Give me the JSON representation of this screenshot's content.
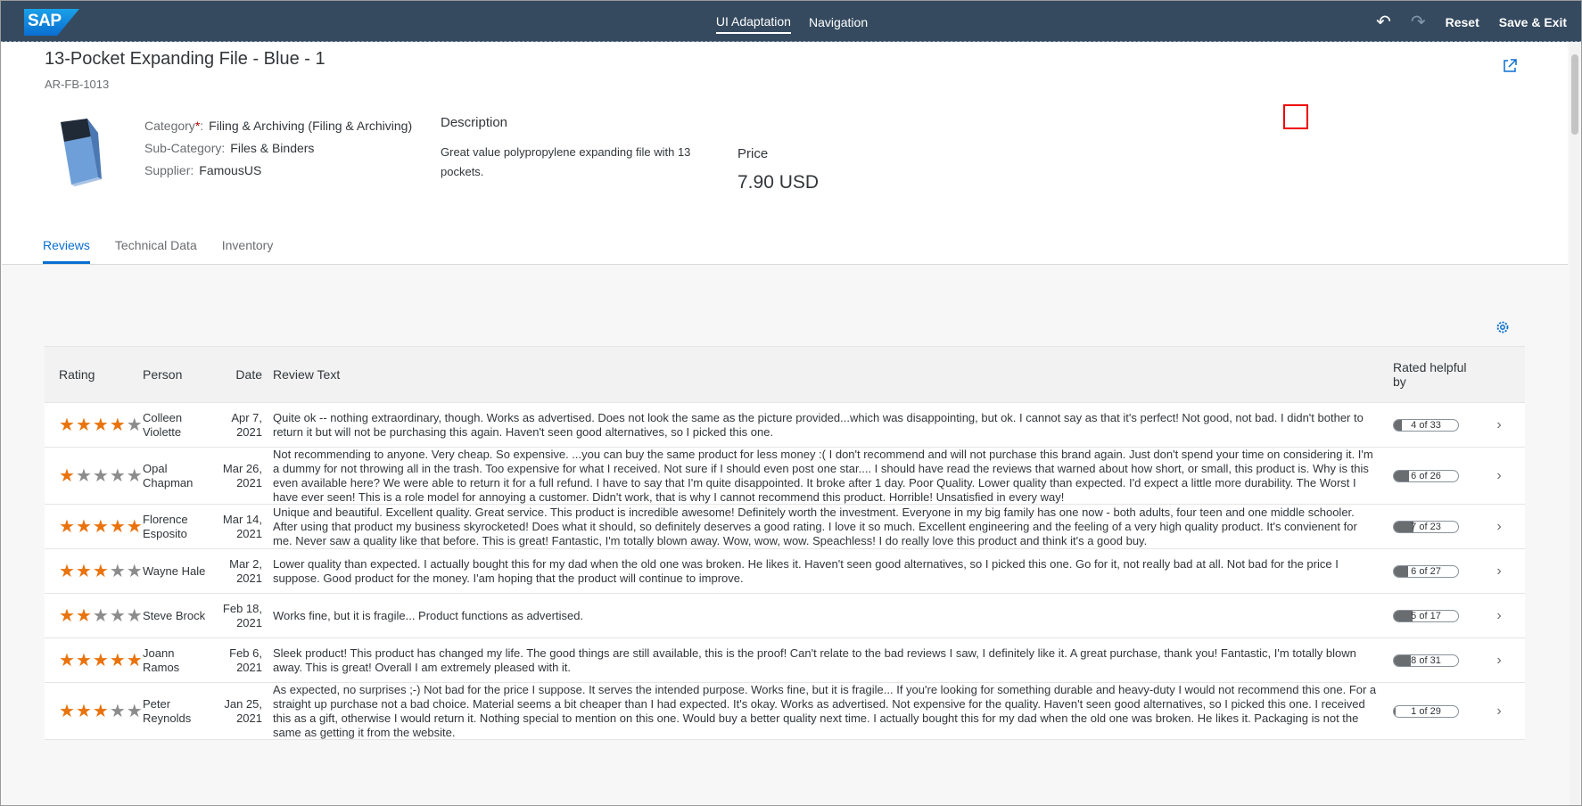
{
  "shell": {
    "logo": "SAP",
    "tabs": [
      "UI Adaptation",
      "Navigation"
    ],
    "reset": "Reset",
    "save_exit": "Save & Exit"
  },
  "header": {
    "title": "13-Pocket Expanding File - Blue - 1",
    "subtitle": "AR-FB-1013",
    "category_label": "Category",
    "category_value": "Filing & Archiving (Filing & Archiving)",
    "subcategory_label": "Sub-Category:",
    "subcategory_value": "Files & Binders",
    "supplier_label": "Supplier:",
    "supplier_value": "FamousUS",
    "description_title": "Description",
    "description_text": "Great value polypropylene expanding file with 13 pockets.",
    "price_title": "Price",
    "price_value": "7.90  USD"
  },
  "tabs": [
    "Reviews",
    "Technical Data",
    "Inventory"
  ],
  "table": {
    "columns": [
      "Rating",
      "Person",
      "Date",
      "Review Text",
      "Rated helpful by"
    ],
    "rows": [
      {
        "rating": 4,
        "person": "Colleen Violette",
        "date": "Apr 7, 2021",
        "text": "Quite ok -- nothing extraordinary, though. Works as advertised. Does not look the same as the picture provided...which was disappointing, but ok. I cannot say as that it's perfect! Not good, not bad. I didn't bother to return it but will not be purchasing this again. Haven't seen good alternatives, so I picked this one.",
        "helpful": "4 of 33",
        "helpful_fraction": 0.12
      },
      {
        "rating": 1,
        "person": "Opal Chapman",
        "date": "Mar 26, 2021",
        "text": "Not recommending to anyone. Very cheap. So expensive. ...you can buy the same product for less money :( I don't recommend and will not purchase this brand again. Just don't spend your time on considering it. I'm a dummy for not throwing all in the trash. Too expensive for what I received. Not sure if I should even post one star.... I should have read the reviews that warned about how short, or small, this product is. Why is this even available here? We were able to return it for a full refund. I have to say that I'm quite disappointed. It broke after 1 day. Poor Quality. Lower quality than expected. I'd expect a little more durability. The Worst I have ever seen! This is a role model for annoying a customer. Didn't work, that is why I cannot recommend this product. Horrible! Unsatisfied in every way!",
        "helpful": "6 of 26",
        "helpful_fraction": 0.23
      },
      {
        "rating": 5,
        "person": "Florence Esposito",
        "date": "Mar 14, 2021",
        "text": "Unique and beautiful. Excellent quality. Great service. This product is incredible awesome! Definitely worth the investment. Everyone in my big family has one now - both adults, four teen and one middle schooler. After using that product my business skyrocketed! Does what it should, so definitely deserves a good rating. I love it so much. Excellent engineering and the feeling of a very high quality product. It's convienent for me. Never saw a quality like that before. This is great! Fantastic, I'm totally blown away. Wow, wow, wow. Speachless! I do really love this product and think it's a good buy.",
        "helpful": "7 of 23",
        "helpful_fraction": 0.3
      },
      {
        "rating": 3,
        "person": "Wayne Hale",
        "date": "Mar 2, 2021",
        "text": "Lower quality than expected. I actually bought this for my dad when the old one was broken. He likes it. Haven't seen good alternatives, so I picked this one. Go for it, not really bad at all. Not bad for the price I suppose. Good product for the money. I'am hoping that the product will continue to improve.",
        "helpful": "6 of 27",
        "helpful_fraction": 0.22
      },
      {
        "rating": 2,
        "person": "Steve Brock",
        "date": "Feb 18, 2021",
        "text": "Works fine, but it is fragile... Product functions as advertised.",
        "helpful": "5 of 17",
        "helpful_fraction": 0.29
      },
      {
        "rating": 5,
        "person": "Joann Ramos",
        "date": "Feb 6, 2021",
        "text": "Sleek product! This product has changed my life. The good things are still available, this is the proof! Can't relate to the bad reviews I saw, I definitely like it. A great purchase, thank you! Fantastic, I'm totally blown away. This is great! Overall I am extremely pleased with it.",
        "helpful": "8 of 31",
        "helpful_fraction": 0.26
      },
      {
        "rating": 3,
        "person": "Peter Reynolds",
        "date": "Jan 25, 2021",
        "text": "As expected, no surprises ;-) Not bad for the price I suppose. It serves the intended purpose. Works fine, but it is fragile... If you're looking for something durable and heavy-duty I would not recommend this one. For a straight up purchase not a bad choice. Material seems a bit cheaper than I had expected. It's okay. Works as advertised. Not expensive for the quality. Haven't seen good alternatives, so I picked this one. I received this as a gift, otherwise I would return it. Nothing special to mention on this one. Would buy a better quality next time. I actually bought this for my dad when the old one was broken. He likes it. Packaging is not the same as getting it from the website.",
        "helpful": "1 of 29",
        "helpful_fraction": 0.03
      }
    ]
  },
  "colors": {
    "shell": "#354a5f",
    "accent": "#0a6ed1",
    "star": "#e9730c"
  }
}
